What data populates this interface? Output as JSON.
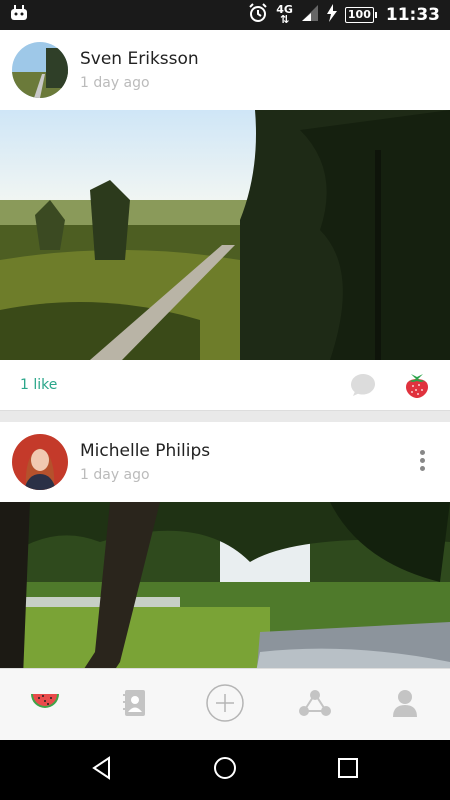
{
  "status_bar": {
    "network": "4G",
    "battery": "100",
    "time": "11:33"
  },
  "posts": [
    {
      "author": "Sven Eriksson",
      "time": "1 day ago",
      "likes": "1 like"
    },
    {
      "author": "Michelle Philips",
      "time": "1 day ago"
    }
  ],
  "tabs": [
    {
      "icon": "watermelon-icon",
      "active": true
    },
    {
      "icon": "address-book-icon"
    },
    {
      "icon": "add-circle-icon"
    },
    {
      "icon": "share-network-icon"
    },
    {
      "icon": "profile-icon"
    }
  ],
  "colors": {
    "accent": "#2aa68a",
    "strawberry": "#e0323e",
    "watermelon": "#e94b4b",
    "inactive_icon": "#c4c4c4"
  }
}
